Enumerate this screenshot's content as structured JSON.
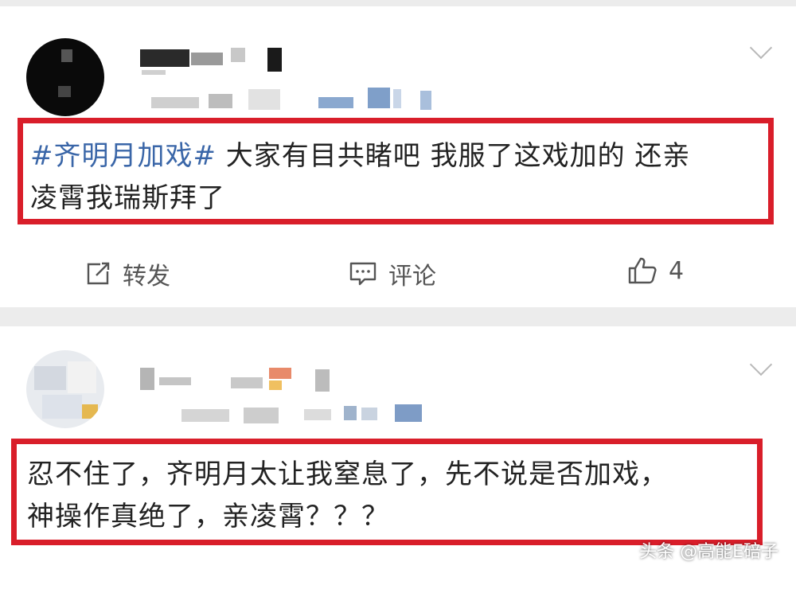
{
  "posts": [
    {
      "hashtag": "#齐明月加戏#",
      "text_line1": " 大家有目共睹吧 我服了这戏加的 还亲",
      "text_line2": "凌霄我瑞斯拜了",
      "actions": {
        "repost_label": "转发",
        "comment_label": "评论",
        "like_count": "4"
      }
    },
    {
      "text_line1": "忍不住了，齐明月太让我窒息了，先不说是否加戏，",
      "text_line2": "神操作真绝了，亲凌霄？？？"
    }
  ],
  "watermark": "头条 @高能E碚子",
  "colors": {
    "highlight_border": "#d91e2a",
    "hashtag": "#3a66a8"
  }
}
